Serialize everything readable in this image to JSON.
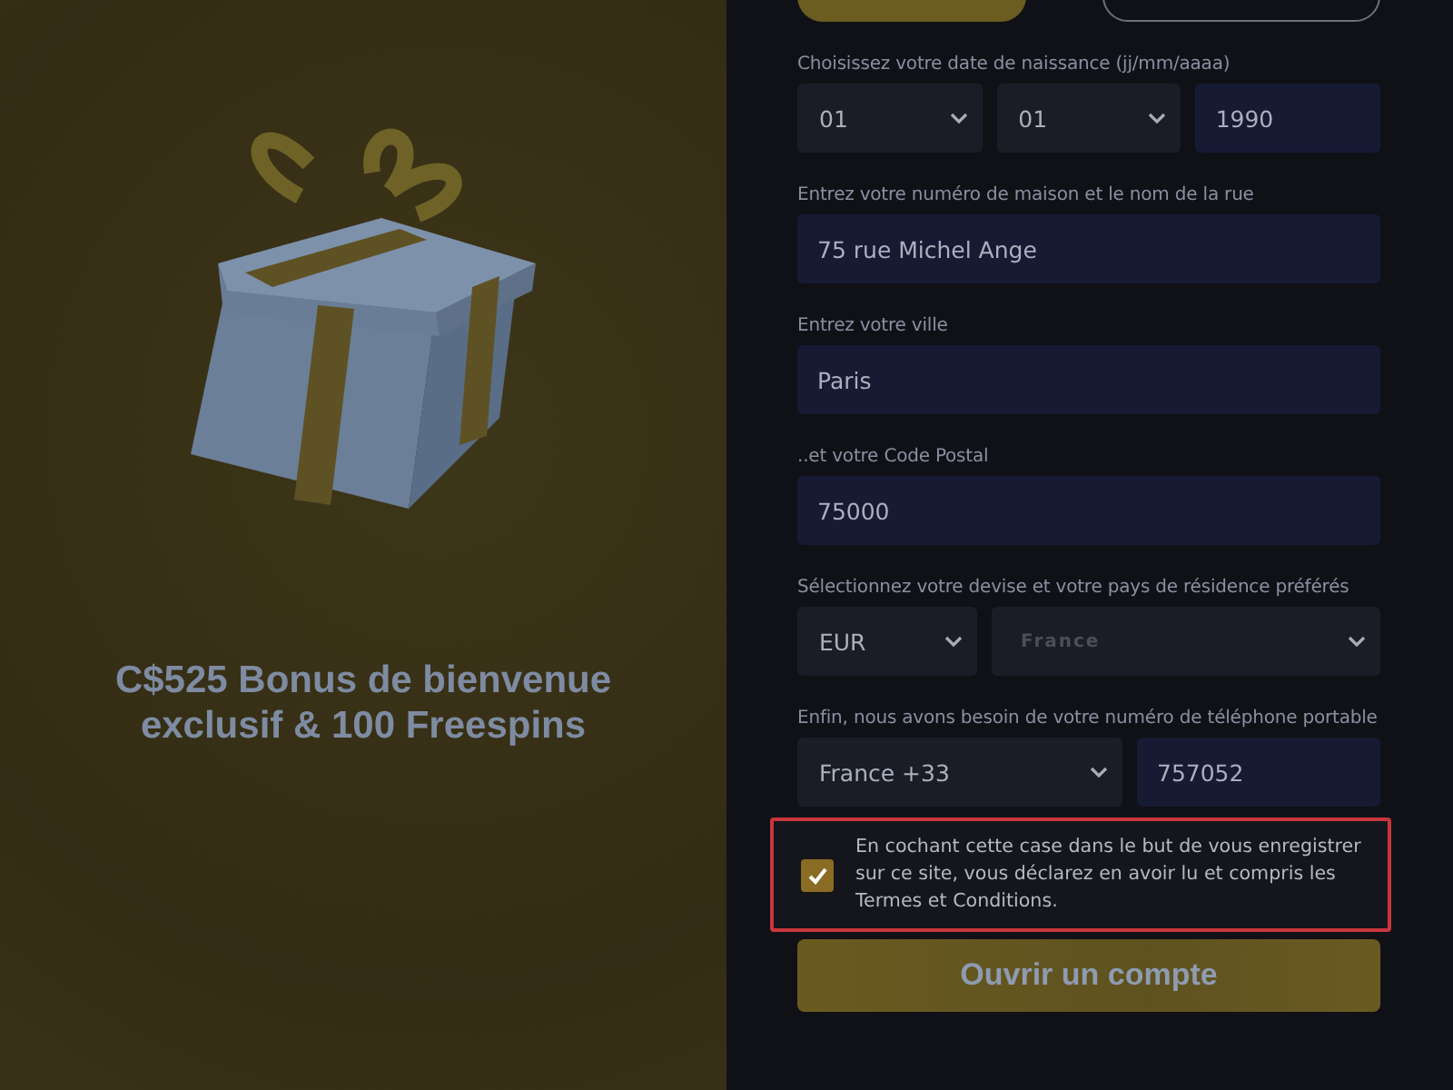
{
  "promo": {
    "headline": "C$525 Bonus de bienvenue exclusif & 100 Freespins"
  },
  "top_buttons": [
    {
      "selected": true
    },
    {
      "selected": false
    }
  ],
  "form": {
    "groups": [
      {
        "label": "Choisissez votre date de naissance (jj/mm/aaaa)",
        "fields": [
          {
            "kind": "select",
            "value": "01"
          },
          {
            "kind": "select",
            "value": "01"
          },
          {
            "kind": "input",
            "value": "1990"
          }
        ]
      },
      {
        "label": "Entrez votre numéro de maison et le nom de la rue",
        "fields": [
          {
            "kind": "input",
            "value": "75 rue Michel Ange"
          }
        ]
      },
      {
        "label": "Entrez votre ville",
        "fields": [
          {
            "kind": "input",
            "value": "Paris"
          }
        ]
      },
      {
        "label": "..et votre Code Postal",
        "fields": [
          {
            "kind": "input",
            "value": "75000"
          }
        ]
      },
      {
        "label": "Sélectionnez votre devise et votre pays de résidence préférés",
        "fields": [
          {
            "kind": "select",
            "value": "EUR"
          },
          {
            "kind": "select",
            "placeholder": "France"
          }
        ]
      },
      {
        "label": "Enfin, nous avons besoin de votre numéro de téléphone portable",
        "fields": [
          {
            "kind": "select",
            "value": "France +33"
          },
          {
            "kind": "input",
            "value": "757052"
          }
        ]
      }
    ]
  },
  "consent": {
    "checked": true,
    "text": "En cochant cette case dans le but de vous enregistrer sur ce site, vous déclarez en avoir lu et compris les Termes et Conditions."
  },
  "submit": {
    "label": "Ouvrir un compte"
  }
}
